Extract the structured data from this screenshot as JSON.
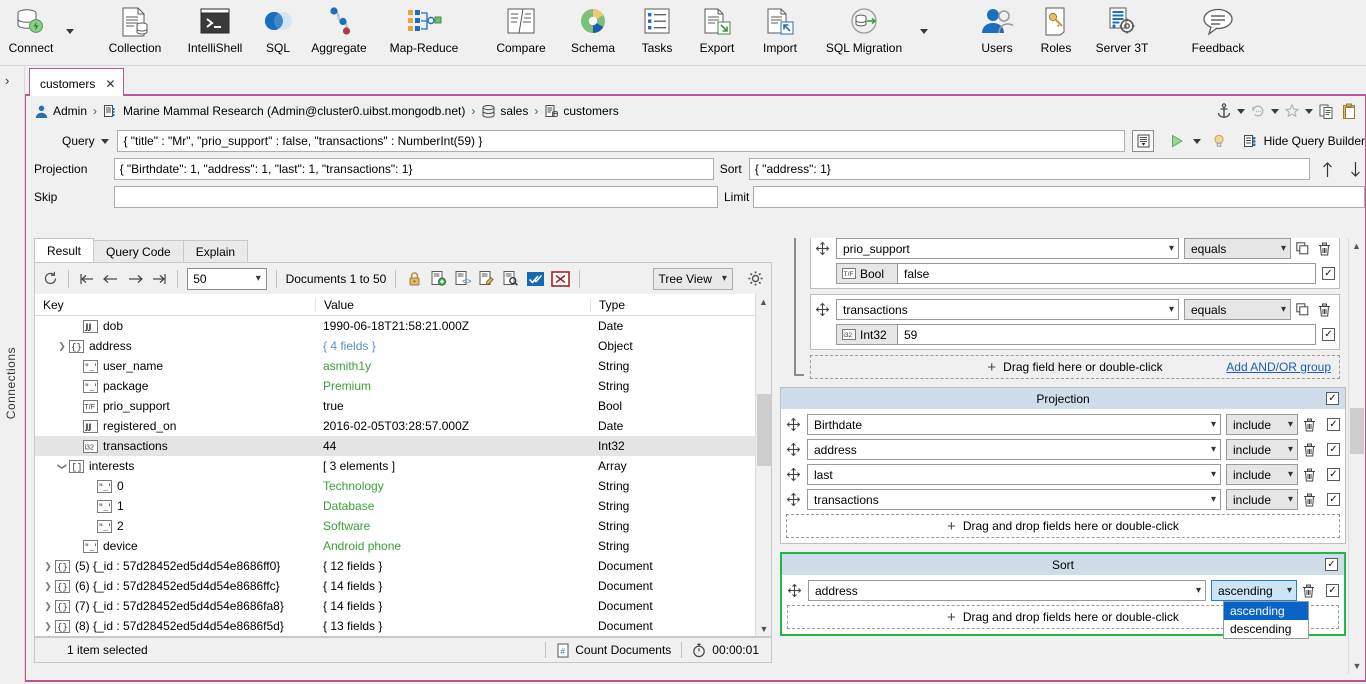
{
  "ribbon": {
    "items": [
      {
        "label": "Connect",
        "icon": "connect-icon",
        "caret": true
      },
      {
        "label": "Collection",
        "icon": "collection-icon",
        "caret": false
      },
      {
        "label": "IntelliShell",
        "icon": "intellishell-icon",
        "caret": false
      },
      {
        "label": "SQL",
        "icon": "sql-icon",
        "caret": false
      },
      {
        "label": "Aggregate",
        "icon": "aggregate-icon",
        "caret": false
      },
      {
        "label": "Map-Reduce",
        "icon": "map-reduce-icon",
        "caret": false
      },
      {
        "label": "Compare",
        "icon": "compare-icon",
        "caret": false
      },
      {
        "label": "Schema",
        "icon": "schema-icon",
        "caret": false
      },
      {
        "label": "Tasks",
        "icon": "tasks-icon",
        "caret": false
      },
      {
        "label": "Export",
        "icon": "export-icon",
        "caret": false
      },
      {
        "label": "Import",
        "icon": "import-icon",
        "caret": false
      },
      {
        "label": "SQL Migration",
        "icon": "sql-migration-icon",
        "caret": true
      },
      {
        "label": "Users",
        "icon": "users-icon",
        "caret": false
      },
      {
        "label": "Roles",
        "icon": "roles-icon",
        "caret": false
      },
      {
        "label": "Server 3T",
        "icon": "server-3t-icon",
        "caret": false
      },
      {
        "label": "Feedback",
        "icon": "feedback-icon",
        "caret": false
      }
    ]
  },
  "left_rail": {
    "connections_label": "Connections",
    "expand_glyph": "›"
  },
  "tab": {
    "title": "customers",
    "close_glyph": "✕"
  },
  "breadcrumb": {
    "user": "Admin",
    "connection": "Marine Mammal Research (Admin@cluster0.uibst.mongodb.net)",
    "database": "sales",
    "collection": "customers",
    "separator": "›"
  },
  "query_bar": {
    "query_label": "Query",
    "query_value": "{ \"title\" : \"Mr\", \"prio_support\" : false, \"transactions\" : NumberInt(59) }",
    "projection_label": "Projection",
    "projection_value": "{ \"Birthdate\": 1, \"address\": 1, \"last\": 1, \"transactions\": 1}",
    "skip_label": "Skip",
    "skip_value": "",
    "sort_label": "Sort",
    "sort_value": "{ \"address\": 1}",
    "limit_label": "Limit",
    "limit_value": "",
    "hide_query_builder": "Hide Query Builder"
  },
  "top_icons": [
    {
      "name": "anchor-icon"
    },
    {
      "name": "anchor-dropdown-caret"
    },
    {
      "name": "history-icon"
    },
    {
      "name": "history-dropdown-caret"
    },
    {
      "name": "favorite-star-icon"
    },
    {
      "name": "favorite-dropdown-caret"
    },
    {
      "name": "copy-icon"
    },
    {
      "name": "paste-icon"
    }
  ],
  "result": {
    "tabs": [
      {
        "label": "Result",
        "active": true
      },
      {
        "label": "Query Code",
        "active": false
      },
      {
        "label": "Explain",
        "active": false
      }
    ],
    "toolbar": {
      "page_size": "50",
      "documents_range": "Documents 1 to 50",
      "view_mode": "Tree View",
      "icons": [
        {
          "name": "refresh-icon"
        },
        {
          "name": "first-page-icon"
        },
        {
          "name": "previous-page-icon"
        },
        {
          "name": "next-page-icon"
        },
        {
          "name": "last-page-icon"
        },
        {
          "name": "lock-icon"
        },
        {
          "name": "add-document-icon"
        },
        {
          "name": "view-document-icon"
        },
        {
          "name": "edit-document-icon"
        },
        {
          "name": "find-document-icon"
        },
        {
          "name": "commit-changes-icon"
        },
        {
          "name": "discard-changes-icon"
        },
        {
          "name": "settings-gear-icon"
        }
      ]
    },
    "columns": [
      "Key",
      "Value",
      "Type"
    ],
    "rows": [
      {
        "indent": 2,
        "twisty": "",
        "icon": "date",
        "key": "dob",
        "value": "1990-06-18T21:58:21.000Z",
        "type": "Date",
        "value_color": "black",
        "selected": false
      },
      {
        "indent": 1,
        "twisty": "›",
        "icon": "object",
        "key": "address",
        "value": "{ 4 fields }",
        "type": "Object",
        "value_color": "blue",
        "selected": false
      },
      {
        "indent": 2,
        "twisty": "",
        "icon": "string",
        "key": "user_name",
        "value": "asmith1y",
        "type": "String",
        "value_color": "green",
        "selected": false
      },
      {
        "indent": 2,
        "twisty": "",
        "icon": "string",
        "key": "package",
        "value": "Premium",
        "type": "String",
        "value_color": "green",
        "selected": false
      },
      {
        "indent": 2,
        "twisty": "",
        "icon": "bool",
        "key": "prio_support",
        "value": "true",
        "type": "Bool",
        "value_color": "black",
        "selected": false
      },
      {
        "indent": 2,
        "twisty": "",
        "icon": "date",
        "key": "registered_on",
        "value": "2016-02-05T03:28:57.000Z",
        "type": "Date",
        "value_color": "black",
        "selected": false
      },
      {
        "indent": 2,
        "twisty": "",
        "icon": "int32",
        "key": "transactions",
        "value": "44",
        "type": "Int32",
        "value_color": "black",
        "selected": true
      },
      {
        "indent": 1,
        "twisty": "⌄",
        "icon": "array",
        "key": "interests",
        "value": "[ 3 elements ]",
        "type": "Array",
        "value_color": "black",
        "selected": false
      },
      {
        "indent": 3,
        "twisty": "",
        "icon": "string",
        "key": "0",
        "value": "Technology",
        "type": "String",
        "value_color": "green",
        "selected": false
      },
      {
        "indent": 3,
        "twisty": "",
        "icon": "string",
        "key": "1",
        "value": "Database",
        "type": "String",
        "value_color": "green",
        "selected": false
      },
      {
        "indent": 3,
        "twisty": "",
        "icon": "string",
        "key": "2",
        "value": "Software",
        "type": "String",
        "value_color": "green",
        "selected": false
      },
      {
        "indent": 2,
        "twisty": "",
        "icon": "string",
        "key": "device",
        "value": "Android phone",
        "type": "String",
        "value_color": "green",
        "selected": false
      },
      {
        "indent": 0,
        "twisty": "›",
        "icon": "object",
        "key": "(5) {_id : 57d28452ed5d4d54e8686ff0}",
        "value": "{ 12 fields }",
        "type": "Document",
        "value_color": "black",
        "selected": false
      },
      {
        "indent": 0,
        "twisty": "›",
        "icon": "object",
        "key": "(6) {_id : 57d28452ed5d4d54e8686ffc}",
        "value": "{ 14 fields }",
        "type": "Document",
        "value_color": "black",
        "selected": false
      },
      {
        "indent": 0,
        "twisty": "›",
        "icon": "object",
        "key": "(7) {_id : 57d28452ed5d4d54e8686fa8}",
        "value": "{ 14 fields }",
        "type": "Document",
        "value_color": "black",
        "selected": false
      },
      {
        "indent": 0,
        "twisty": "›",
        "icon": "object",
        "key": "(8) {_id : 57d28452ed5d4d54e8686f5d}",
        "value": "{ 13 fields }",
        "type": "Document",
        "value_color": "black",
        "selected": false
      }
    ],
    "status": {
      "selection": "1 item selected",
      "count_documents": "Count Documents",
      "elapsed": "00:00:01"
    }
  },
  "query_builder": {
    "criteria": [
      {
        "field": "prio_support",
        "operator": "equals",
        "type_badge": "Bool",
        "type_icon": "T/F",
        "value": "false",
        "enabled": true,
        "partial_top": true
      },
      {
        "field": "transactions",
        "operator": "equals",
        "type_badge": "Int32",
        "type_icon": "i32",
        "value": "59",
        "enabled": true,
        "partial_top": false
      }
    ],
    "criteria_drop_hint": "Drag field here or double-click",
    "add_group_link": "Add AND/OR group",
    "projection": {
      "title": "Projection",
      "enabled": true,
      "rows": [
        {
          "field": "Birthdate",
          "mode": "include",
          "enabled": true
        },
        {
          "field": "address",
          "mode": "include",
          "enabled": true
        },
        {
          "field": "last",
          "mode": "include",
          "enabled": true
        },
        {
          "field": "transactions",
          "mode": "include",
          "enabled": true
        }
      ],
      "drop_hint": "Drag and drop fields here or double-click"
    },
    "sort": {
      "title": "Sort",
      "enabled": true,
      "highlighted": true,
      "rows": [
        {
          "field": "address",
          "direction": "ascending",
          "enabled": true
        }
      ],
      "direction_options": [
        "ascending",
        "descending"
      ],
      "selected_option": "ascending",
      "drop_hint": "Drag and drop fields here or double-click"
    }
  },
  "colors": {
    "accent_tab": "#b4589a",
    "sort_highlight": "#21b54a",
    "panel_header": "#cfdcea",
    "dropdown_selected": "#0a64c8",
    "link": "#1a5fb4",
    "value_string": "#3a9f3a",
    "value_object": "#5a8fc0"
  }
}
